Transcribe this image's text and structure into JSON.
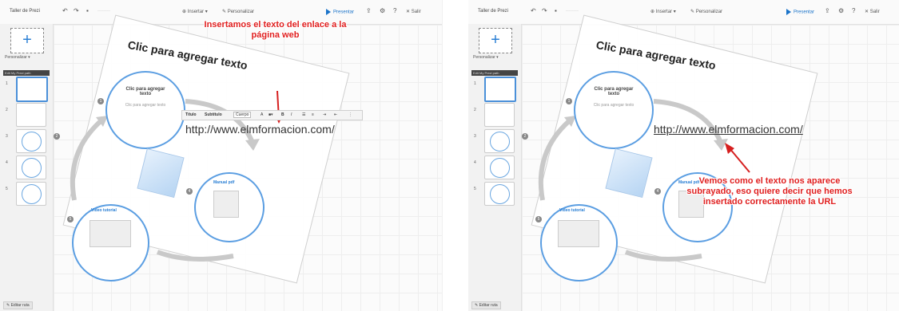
{
  "app": {
    "title": "Taller de Prezi",
    "menu_insert": "Insertar",
    "menu_customize": "Personalizar",
    "present": "Presentar",
    "exit": "Salir",
    "add_label": "+",
    "customize_label": "Personalizar",
    "path_header": "Edit My Prezi path",
    "edit_path": "Editar ruta",
    "thumb_numbers": [
      "1",
      "2",
      "3",
      "4",
      "5"
    ]
  },
  "canvas": {
    "heading": "Clic para agregar texto",
    "circle1_title": "Clic para agregar texto",
    "circle1_sub": "Clic para agregar texto",
    "manual_title": "Manual pdf",
    "video_title": "Video tutorial",
    "step_numbers": [
      "1",
      "2",
      "3",
      "4",
      "5"
    ],
    "url": "http://www.elmformacion.com/"
  },
  "toolbar": {
    "titulo": "Título",
    "subtitulo": "Subtítulo",
    "cuerpo": "Cuerpo",
    "size_a": "A",
    "bold": "B",
    "italic": "I"
  },
  "annotations": {
    "left": "Insertamos el texto del enlace a la página web",
    "right": "Vemos como el texto nos aparece subrayado, eso quiere decir que hemos insertado correctamente la URL"
  },
  "colors": {
    "accent": "#1a73c9",
    "annotation": "#e02020",
    "circle": "#5b9ee2"
  }
}
